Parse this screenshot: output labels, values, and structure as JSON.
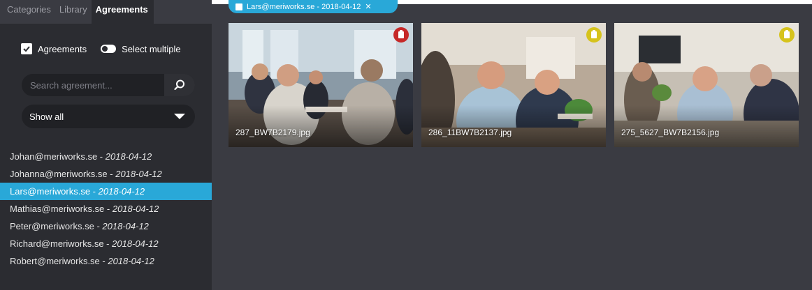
{
  "sidebar": {
    "tabs": [
      {
        "label": "Categories"
      },
      {
        "label": "Library"
      },
      {
        "label": "Agreements"
      }
    ],
    "agreements_label": "Agreements",
    "select_multiple_label": "Select multiple",
    "select_multiple_on": false,
    "search_placeholder": "Search agreement...",
    "filter_selected": "Show all",
    "items": [
      {
        "email": "Johan@meriworks.se",
        "date": "2018-04-12"
      },
      {
        "email": "Johanna@meriworks.se",
        "date": "2018-04-12"
      },
      {
        "email": "Lars@meriworks.se",
        "date": "2018-04-12",
        "selected": true
      },
      {
        "email": "Mathias@meriworks.se",
        "date": "2018-04-12"
      },
      {
        "email": "Peter@meriworks.se",
        "date": "2018-04-12"
      },
      {
        "email": "Richard@meriworks.se",
        "date": "2018-04-12"
      },
      {
        "email": "Robert@meriworks.se",
        "date": "2018-04-12"
      }
    ]
  },
  "main": {
    "active_filter_chip": "Lars@meriworks.se - 2018-04-12",
    "images": [
      {
        "filename": "287_BW7B2179.jpg",
        "status_color": "#c62828"
      },
      {
        "filename": "286_11BW7B2137.jpg",
        "status_color": "#d6c31c"
      },
      {
        "filename": "275_5627_BW7B2156.jpg",
        "status_color": "#d6c31c"
      }
    ]
  },
  "colors": {
    "accent": "#29a8d8",
    "sidebar_bg": "#2b2c31",
    "main_bg": "#3a3b42"
  }
}
